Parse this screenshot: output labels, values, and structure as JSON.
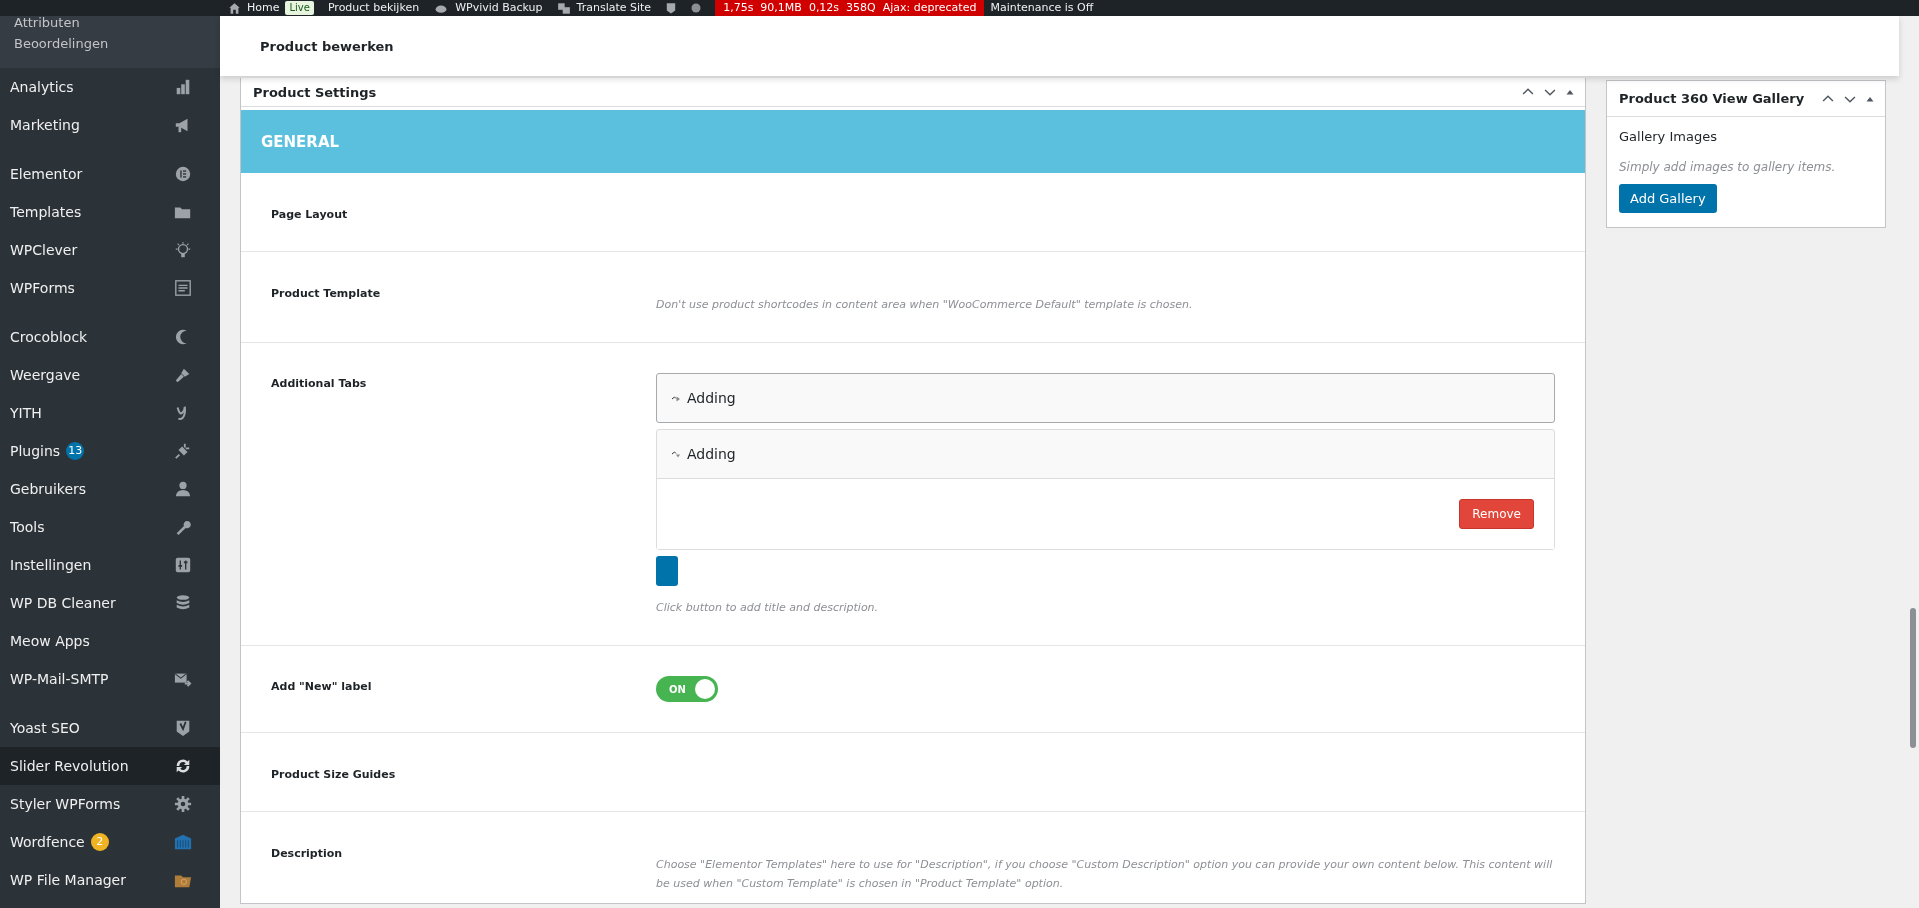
{
  "admin_bar": {
    "home": "Home",
    "live_badge": "Live",
    "items": [
      {
        "label": "Product bekijken"
      },
      {
        "label": "WPvivid Backup"
      },
      {
        "label": "Translate Site"
      }
    ],
    "debug": "1,75s  90,1MB  0,12s  358Q  Ajax: deprecated",
    "maintenance": "Maintenance is Off"
  },
  "sidebar": {
    "submenu": [
      "Attributen",
      "Beoordelingen"
    ],
    "items": [
      {
        "kind": "item",
        "label": "Analytics",
        "selected": false
      },
      {
        "kind": "item",
        "label": "Marketing",
        "selected": false
      },
      {
        "kind": "separator"
      },
      {
        "kind": "item",
        "label": "Elementor",
        "selected": false
      },
      {
        "kind": "item",
        "label": "Templates",
        "selected": false
      },
      {
        "kind": "item",
        "label": "WPClever",
        "selected": false
      },
      {
        "kind": "item",
        "label": "WPForms",
        "selected": false
      },
      {
        "kind": "separator"
      },
      {
        "kind": "item",
        "label": "Crocoblock",
        "selected": false
      },
      {
        "kind": "item",
        "label": "Weergave",
        "selected": false
      },
      {
        "kind": "item",
        "label": "YITH",
        "selected": false
      },
      {
        "kind": "item",
        "label": "Plugins",
        "selected": false,
        "badge": {
          "text": "13",
          "color": "#0073aa"
        }
      },
      {
        "kind": "item",
        "label": "Gebruikers",
        "selected": false
      },
      {
        "kind": "item",
        "label": "Tools",
        "selected": false
      },
      {
        "kind": "item",
        "label": "Instellingen",
        "selected": false
      },
      {
        "kind": "item",
        "label": "WP DB Cleaner",
        "selected": false
      },
      {
        "kind": "item",
        "label": "Meow Apps",
        "selected": false
      },
      {
        "kind": "item",
        "label": "WP-Mail-SMTP",
        "selected": false
      },
      {
        "kind": "separator"
      },
      {
        "kind": "item",
        "label": "Yoast SEO",
        "selected": false
      },
      {
        "kind": "item",
        "label": "Slider Revolution",
        "selected": true
      },
      {
        "kind": "item",
        "label": "Styler WPForms",
        "selected": false
      },
      {
        "kind": "item",
        "label": "Wordfence",
        "selected": false,
        "badge": {
          "text": "2",
          "color": "#f0b323"
        }
      },
      {
        "kind": "item",
        "label": "WP File Manager",
        "selected": false
      }
    ]
  },
  "page_header": "Product bewerken",
  "settings_box": {
    "title": "Product Settings",
    "section": "GENERAL",
    "rows": [
      {
        "kind": "plain",
        "label": "Page Layout"
      },
      {
        "kind": "hint",
        "label": "Product Template",
        "hint": "Don't use product shortcodes in content area when \"WooCommerce Default\" template is chosen."
      },
      {
        "kind": "tabs",
        "label": "Additional Tabs",
        "tabs": [
          {
            "title": "Adding",
            "expanded": false
          },
          {
            "title": "Adding",
            "expanded": true,
            "remove": "Remove"
          }
        ],
        "hint": "Click button to add title and description."
      },
      {
        "kind": "toggle",
        "label": "Add \"New\" label",
        "on": true,
        "toggle_text": "ON"
      },
      {
        "kind": "plain",
        "label": "Product Size Guides"
      },
      {
        "kind": "hint",
        "label": "Description",
        "hint": "Choose \"Elementor Templates\" here to use for \"Description\", if you choose \"Custom Description\" option you can provide your own content below. This content will be used when \"Custom Template\" is chosen in \"Product Template\" option."
      }
    ]
  },
  "gallery_box": {
    "title": "Product 360 View Gallery",
    "heading": "Gallery Images",
    "hint": "Simply add images to gallery items.",
    "button": "Add Gallery"
  }
}
